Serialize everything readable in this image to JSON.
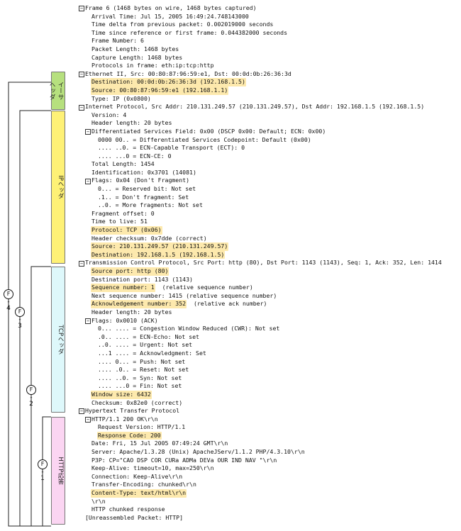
{
  "colors": {
    "highlight": "#fde9ad",
    "ethernet_band": "#b6e07e",
    "ip_band": "#fef176",
    "tcp_band": "#def8fb",
    "http_band": "#fbd5f2",
    "bracket_line": "#222222"
  },
  "toggle_icon": "collapse-minus-icon",
  "packet_lines": [
    {
      "text": "Frame 6 (1468 bytes on wire, 1468 bytes captured)",
      "indent": 0,
      "toggle": true,
      "highlight": false
    },
    {
      "text": "Arrival Time: Jul 15, 2005 16:49:24.748143000",
      "indent": 1,
      "toggle": false,
      "highlight": false
    },
    {
      "text": "Time delta from previous packet: 0.002019000 seconds",
      "indent": 1,
      "toggle": false,
      "highlight": false
    },
    {
      "text": "Time since reference or first frame: 0.044382000 seconds",
      "indent": 1,
      "toggle": false,
      "highlight": false
    },
    {
      "text": "Frame Number: 6",
      "indent": 1,
      "toggle": false,
      "highlight": false
    },
    {
      "text": "Packet Length: 1468 bytes",
      "indent": 1,
      "toggle": false,
      "highlight": false
    },
    {
      "text": "Capture Length: 1468 bytes",
      "indent": 1,
      "toggle": false,
      "highlight": false
    },
    {
      "text": "Protocols in frame: eth:ip:tcp:http",
      "indent": 1,
      "toggle": false,
      "highlight": false
    },
    {
      "text": "Ethernet II, Src: 00:80:87:96:59:e1, Dst: 00:0d:0b:26:36:3d",
      "indent": 0,
      "toggle": true,
      "highlight": false
    },
    {
      "text": "Destination: 00:0d:0b:26:36:3d (192.168.1.5)",
      "indent": 1,
      "toggle": false,
      "highlight": true
    },
    {
      "text": "Source: 00:80:87:96:59:e1 (192.168.1.1)",
      "indent": 1,
      "toggle": false,
      "highlight": true
    },
    {
      "text": "Type: IP (0x0800)",
      "indent": 1,
      "toggle": false,
      "highlight": false
    },
    {
      "text": "Internet Protocol, Src Addr: 210.131.249.57 (210.131.249.57), Dst Addr: 192.168.1.5 (192.168.1.5)",
      "indent": 0,
      "toggle": true,
      "highlight": false
    },
    {
      "text": "Version: 4",
      "indent": 1,
      "toggle": false,
      "highlight": false
    },
    {
      "text": "Header length: 20 bytes",
      "indent": 1,
      "toggle": false,
      "highlight": false
    },
    {
      "text": "Differentiated Services Field: 0x00 (DSCP 0x00: Default; ECN: 0x00)",
      "indent": 1,
      "toggle": true,
      "highlight": false
    },
    {
      "text": "0000 00.. = Differentiated Services Codepoint: Default (0x00)",
      "indent": 2,
      "toggle": false,
      "highlight": false
    },
    {
      "text": ".... ..0. = ECN-Capable Transport (ECT): 0",
      "indent": 2,
      "toggle": false,
      "highlight": false
    },
    {
      "text": ".... ...0 = ECN-CE: 0",
      "indent": 2,
      "toggle": false,
      "highlight": false
    },
    {
      "text": "Total Length: 1454",
      "indent": 1,
      "toggle": false,
      "highlight": false
    },
    {
      "text": "Identification: 0x3701 (14081)",
      "indent": 1,
      "toggle": false,
      "highlight": false
    },
    {
      "text": "Flags: 0x04 (Don't Fragment)",
      "indent": 1,
      "toggle": true,
      "highlight": false
    },
    {
      "text": "0... = Reserved bit: Not set",
      "indent": 2,
      "toggle": false,
      "highlight": false
    },
    {
      "text": ".1.. = Don't fragment: Set",
      "indent": 2,
      "toggle": false,
      "highlight": false
    },
    {
      "text": "..0. = More fragments: Not set",
      "indent": 2,
      "toggle": false,
      "highlight": false
    },
    {
      "text": "Fragment offset: 0",
      "indent": 1,
      "toggle": false,
      "highlight": false
    },
    {
      "text": "Time to live: 51",
      "indent": 1,
      "toggle": false,
      "highlight": false
    },
    {
      "text": "Protocol: TCP (0x06)",
      "indent": 1,
      "toggle": false,
      "highlight": true
    },
    {
      "text": "Header checksum: 0x7dde (correct)",
      "indent": 1,
      "toggle": false,
      "highlight": false
    },
    {
      "text": "Source: 210.131.249.57 (210.131.249.57)",
      "indent": 1,
      "toggle": false,
      "highlight": true
    },
    {
      "text": "Destination: 192.168.1.5 (192.168.1.5)",
      "indent": 1,
      "toggle": false,
      "highlight": true
    },
    {
      "text": "Transmission Control Protocol, Src Port: http (80), Dst Port: 1143 (1143), Seq: 1, Ack: 352, Len: 1414",
      "indent": 0,
      "toggle": true,
      "highlight": false
    },
    {
      "text": "Source port: http (80)",
      "indent": 1,
      "toggle": false,
      "highlight": true
    },
    {
      "text": "Destination port: 1143 (1143)",
      "indent": 1,
      "toggle": false,
      "highlight": false
    },
    {
      "text": "Sequence number: 1",
      "suffix": "  (relative sequence number)",
      "indent": 1,
      "toggle": false,
      "highlight": true
    },
    {
      "text": "Next sequence number: 1415  (relative sequence number)",
      "indent": 1,
      "toggle": false,
      "highlight": false
    },
    {
      "text": "Acknowledgement number: 352",
      "suffix": "  (relative ack number)",
      "indent": 1,
      "toggle": false,
      "highlight": true
    },
    {
      "text": "Header length: 20 bytes",
      "indent": 1,
      "toggle": false,
      "highlight": false
    },
    {
      "text": "Flags: 0x0010 (ACK)",
      "indent": 1,
      "toggle": true,
      "highlight": false
    },
    {
      "text": "0... .... = Congestion Window Reduced (CWR): Not set",
      "indent": 2,
      "toggle": false,
      "highlight": false
    },
    {
      "text": ".0.. .... = ECN-Echo: Not set",
      "indent": 2,
      "toggle": false,
      "highlight": false
    },
    {
      "text": "..0. .... = Urgent: Not set",
      "indent": 2,
      "toggle": false,
      "highlight": false
    },
    {
      "text": "...1 .... = Acknowledgment: Set",
      "indent": 2,
      "toggle": false,
      "highlight": false
    },
    {
      "text": ".... 0... = Push: Not set",
      "indent": 2,
      "toggle": false,
      "highlight": false
    },
    {
      "text": ".... .0.. = Reset: Not set",
      "indent": 2,
      "toggle": false,
      "highlight": false
    },
    {
      "text": ".... ..0. = Syn: Not set",
      "indent": 2,
      "toggle": false,
      "highlight": false
    },
    {
      "text": ".... ...0 = Fin: Not set",
      "indent": 2,
      "toggle": false,
      "highlight": false
    },
    {
      "text": "Window size: 6432",
      "indent": 1,
      "toggle": false,
      "highlight": true
    },
    {
      "text": "Checksum: 0x82e0 (correct)",
      "indent": 1,
      "toggle": false,
      "highlight": false
    },
    {
      "text": "Hypertext Transfer Protocol",
      "indent": 0,
      "toggle": true,
      "highlight": false
    },
    {
      "text": "HTTP/1.1 200 OK\\r\\n",
      "indent": 1,
      "toggle": true,
      "highlight": false
    },
    {
      "text": "Request Version: HTTP/1.1",
      "indent": 2,
      "toggle": false,
      "highlight": false
    },
    {
      "text": "Response Code: 200",
      "indent": 2,
      "toggle": false,
      "highlight": true
    },
    {
      "text": "Date: Fri, 15 Jul 2005 07:49:24 GMT\\r\\n",
      "indent": 1,
      "toggle": false,
      "highlight": false
    },
    {
      "text": "Server: Apache/1.3.28 (Unix) ApacheJServ/1.1.2 PHP/4.3.10\\r\\n",
      "indent": 1,
      "toggle": false,
      "highlight": false
    },
    {
      "text": "P3P: CP=\"CAO DSP COR CURa ADMa DEVa OUR IND NAV \"\\r\\n",
      "indent": 1,
      "toggle": false,
      "highlight": false
    },
    {
      "text": "Keep-Alive: timeout=10, max=250\\r\\n",
      "indent": 1,
      "toggle": false,
      "highlight": false
    },
    {
      "text": "Connection: Keep-Alive\\r\\n",
      "indent": 1,
      "toggle": false,
      "highlight": false
    },
    {
      "text": "Transfer-Encoding: chunked\\r\\n",
      "indent": 1,
      "toggle": false,
      "highlight": false
    },
    {
      "text": "Content-Type: text/html\\r\\n",
      "indent": 1,
      "toggle": false,
      "highlight": true
    },
    {
      "text": "\\r\\n",
      "indent": 1,
      "toggle": false,
      "highlight": false
    },
    {
      "text": "HTTP chunked response",
      "indent": 1,
      "toggle": false,
      "highlight": false
    },
    {
      "text": "[Unreassembled Packet: HTTP]",
      "indent": 0,
      "toggle": false,
      "highlight": false
    }
  ],
  "layer_bands": {
    "ethernet": {
      "label": "イーサヘッダ"
    },
    "ip": {
      "label": "IPヘッダ"
    },
    "tcp": {
      "label": "TCPヘッダ"
    },
    "http": {
      "label": "HTTP応答"
    }
  },
  "footnotes": [
    {
      "symbol": "F",
      "dash": "-",
      "number": "4"
    },
    {
      "symbol": "F",
      "dash": "-",
      "number": "3"
    },
    {
      "symbol": "F",
      "dash": "-",
      "number": "2"
    },
    {
      "symbol": "F",
      "dash": "-",
      "number": "1"
    }
  ]
}
